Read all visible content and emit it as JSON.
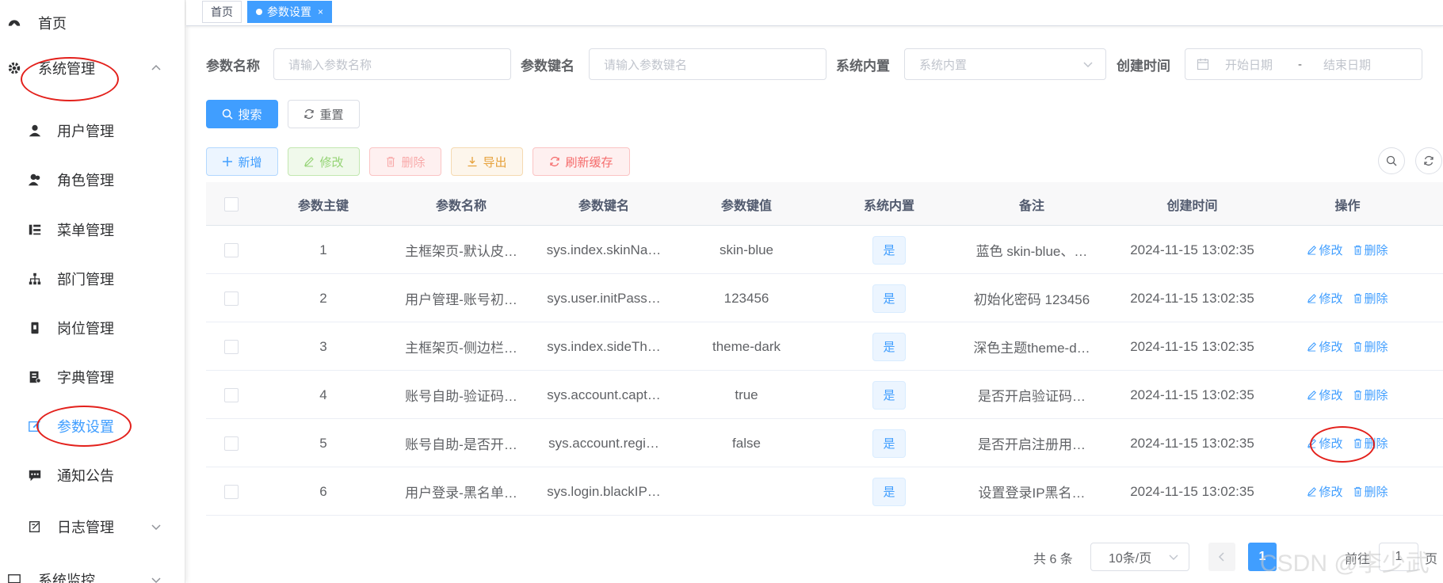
{
  "tabs": [
    {
      "label": "首页",
      "active": false
    },
    {
      "label": "参数设置",
      "active": true,
      "close": "×"
    }
  ],
  "sidebar": {
    "items": [
      {
        "label": "首页",
        "icon": "dashboard-icon",
        "level": "top"
      },
      {
        "label": "系统管理",
        "icon": "gear-icon",
        "level": "top",
        "expanded": true
      },
      {
        "label": "用户管理",
        "icon": "user-icon",
        "level": "sub"
      },
      {
        "label": "角色管理",
        "icon": "peoples-icon",
        "level": "sub"
      },
      {
        "label": "菜单管理",
        "icon": "tree-table-icon",
        "level": "sub"
      },
      {
        "label": "部门管理",
        "icon": "org-tree-icon",
        "level": "sub"
      },
      {
        "label": "岗位管理",
        "icon": "post-icon",
        "level": "sub"
      },
      {
        "label": "字典管理",
        "icon": "dict-icon",
        "level": "sub"
      },
      {
        "label": "参数设置",
        "icon": "edit-icon",
        "level": "sub",
        "active": true
      },
      {
        "label": "通知公告",
        "icon": "message-icon",
        "level": "sub"
      },
      {
        "label": "日志管理",
        "icon": "log-icon",
        "level": "sub",
        "expanded": false
      },
      {
        "label": "系统监控",
        "icon": "monitor-icon",
        "level": "top",
        "expanded": false
      }
    ]
  },
  "search": {
    "config_name_label": "参数名称",
    "config_name_placeholder": "请输入参数名称",
    "config_key_label": "参数键名",
    "config_key_placeholder": "请输入参数键名",
    "config_type_label": "系统内置",
    "config_type_placeholder": "系统内置",
    "create_time_label": "创建时间",
    "start_date_placeholder": "开始日期",
    "range_separator": "-",
    "end_date_placeholder": "结束日期",
    "search_button": "搜索",
    "reset_button": "重置"
  },
  "toolbar": {
    "add": "新增",
    "edit": "修改",
    "delete": "删除",
    "export": "导出",
    "refresh_cache": "刷新缓存"
  },
  "table": {
    "columns": [
      "参数主键",
      "参数名称",
      "参数键名",
      "参数键值",
      "系统内置",
      "备注",
      "创建时间",
      "操作"
    ],
    "edit_label": "修改",
    "delete_label": "删除",
    "rows": [
      {
        "id": "1",
        "name": "主框架页-默认皮…",
        "key": "sys.index.skinNa…",
        "value": "skin-blue",
        "builtin": "是",
        "remark": "蓝色 skin-blue、…",
        "created": "2024-11-15 13:02:35"
      },
      {
        "id": "2",
        "name": "用户管理-账号初…",
        "key": "sys.user.initPass…",
        "value": "123456",
        "builtin": "是",
        "remark": "初始化密码 123456",
        "created": "2024-11-15 13:02:35"
      },
      {
        "id": "3",
        "name": "主框架页-侧边栏…",
        "key": "sys.index.sideTh…",
        "value": "theme-dark",
        "builtin": "是",
        "remark": "深色主题theme-d…",
        "created": "2024-11-15 13:02:35"
      },
      {
        "id": "4",
        "name": "账号自助-验证码…",
        "key": "sys.account.capt…",
        "value": "true",
        "builtin": "是",
        "remark": "是否开启验证码…",
        "created": "2024-11-15 13:02:35"
      },
      {
        "id": "5",
        "name": "账号自助-是否开…",
        "key": "sys.account.regi…",
        "value": "false",
        "builtin": "是",
        "remark": "是否开启注册用…",
        "created": "2024-11-15 13:02:35"
      },
      {
        "id": "6",
        "name": "用户登录-黑名单…",
        "key": "sys.login.blackIP…",
        "value": "",
        "builtin": "是",
        "remark": "设置登录IP黑名…",
        "created": "2024-11-15 13:02:35"
      }
    ]
  },
  "pagination": {
    "total_text": "共 6 条",
    "page_size": "10条/页",
    "current_page": "1",
    "goto_label": "前往",
    "goto_value": "1",
    "page_suffix": "页"
  },
  "watermark": "CSDN @李少武",
  "colors": {
    "primary": "#409eff",
    "annotation": "#e3211c"
  }
}
